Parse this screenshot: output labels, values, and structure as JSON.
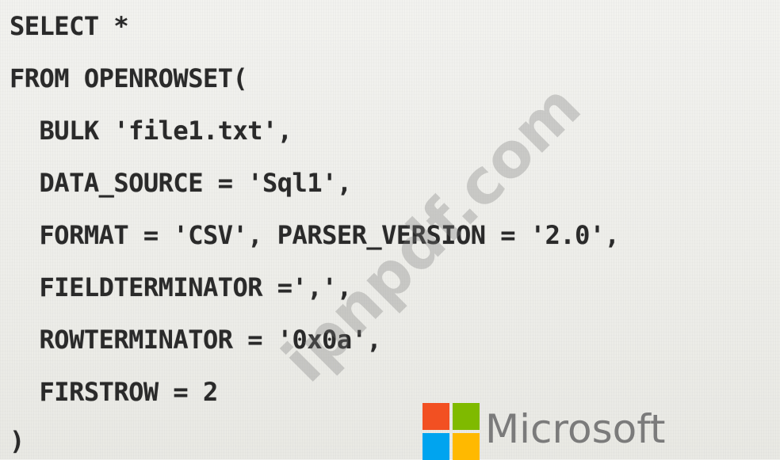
{
  "code": {
    "lines": [
      "SELECT *",
      "FROM OPENROWSET(",
      "  BULK 'file1.txt',",
      "  DATA_SOURCE = 'Sql1',",
      "  FORMAT = 'CSV', PARSER_VERSION = '2.0',",
      "  FIELDTERMINATOR =',',",
      "  ROWTERMINATOR = '0x0a',",
      "  FIRSTROW = 2",
      ")"
    ]
  },
  "watermark": {
    "text": "ipnpdf.com"
  },
  "logo": {
    "text": "Microsoft",
    "colors": [
      "#f25022",
      "#7fba00",
      "#00a4ef",
      "#ffb900"
    ]
  }
}
